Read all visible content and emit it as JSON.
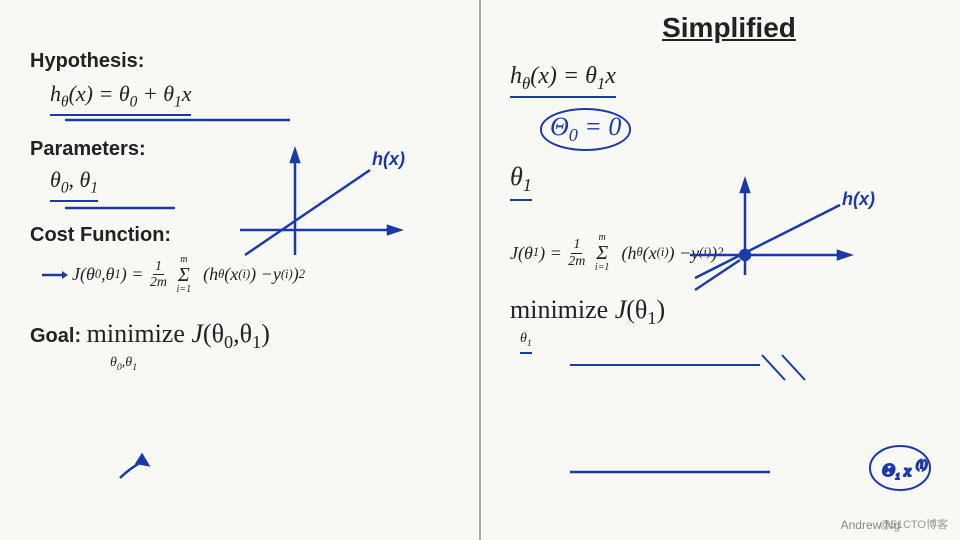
{
  "title": "Simplified",
  "watermark": "@51CTO博客",
  "attribution": "Andrew Ng",
  "left": {
    "sections": [
      {
        "label": "Hypothesis:",
        "content": "h_theta(x) = theta_0 + theta_1 * x"
      },
      {
        "label": "Parameters:",
        "content": "theta_0, theta_1"
      },
      {
        "label": "Cost Function:",
        "content": "J(theta_0, theta_1) = 1/2m sum (h_theta(x^(i)) - y^(i))^2"
      },
      {
        "label": "Goal:",
        "content": "minimize J(theta_0, theta_1)"
      }
    ]
  },
  "right": {
    "hypothesis": "h_theta(x) = theta_1 * x",
    "theta0_equals_0": "theta_0 = 0",
    "parameter": "theta_1",
    "cost": "J(theta_1) = 1/2m sum (h_theta(x^(i)) - y^(i))^2",
    "goal": "minimize J(theta_1)"
  }
}
